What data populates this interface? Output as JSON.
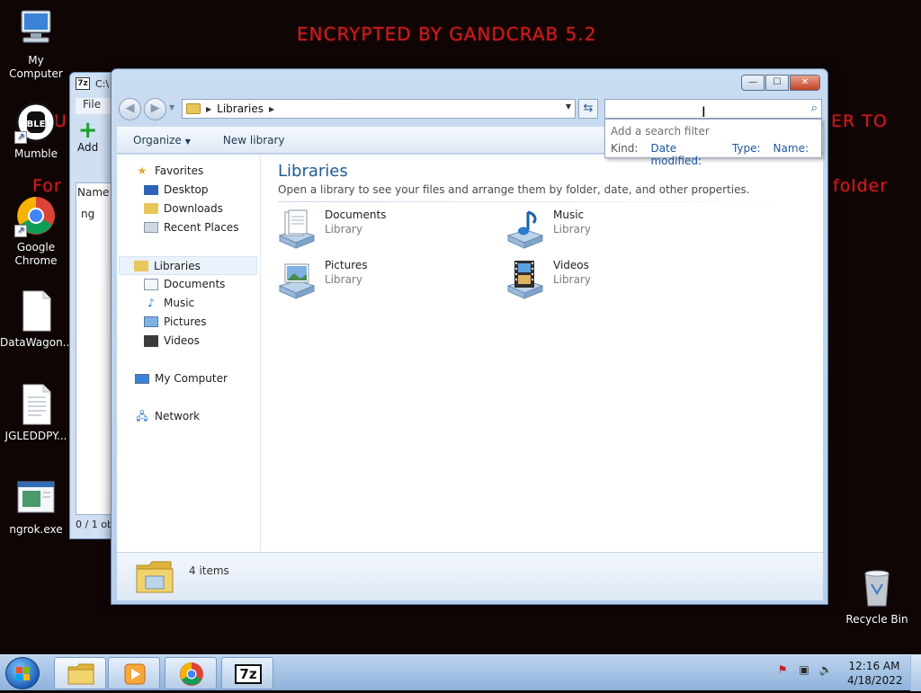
{
  "wallpaper": {
    "title": "ENCRYPTED BY GANDCRAB 5.2",
    "left_fragment_1": "U",
    "left_fragment_2": "For",
    "right_fragment_1": "ER TO",
    "right_fragment_2": "folder"
  },
  "desktop_icons": [
    {
      "label": "My Computer"
    },
    {
      "label": "Mumble"
    },
    {
      "label": "Google Chrome"
    },
    {
      "label": "DataWagon..."
    },
    {
      "label": "JGLEDDPY..."
    },
    {
      "label": "ngrok.exe"
    },
    {
      "label": "Recycle Bin"
    }
  ],
  "bg_window": {
    "app_badge": "7z",
    "title": "C:\\",
    "file_menu": "File",
    "add_label": "Add",
    "col_name": "Name",
    "row_1": "ng",
    "status": "0 / 1 ob"
  },
  "explorer": {
    "caption": {
      "min": "—",
      "max": "☐",
      "close": "✕"
    },
    "address": {
      "crumb": "Libraries"
    },
    "search": {
      "value": "",
      "placeholder": ""
    },
    "search_popup": {
      "hint": "Add a search filter",
      "kind_label": "Kind:",
      "filters": [
        "Date modified:",
        "Type:",
        "Name:"
      ]
    },
    "toolbar": {
      "organize": "Organize",
      "new_library": "New library"
    },
    "nav": {
      "favorites": "Favorites",
      "desktop": "Desktop",
      "downloads": "Downloads",
      "recent": "Recent Places",
      "libraries": "Libraries",
      "documents": "Documents",
      "music": "Music",
      "pictures": "Pictures",
      "videos": "Videos",
      "computer": "My Computer",
      "network": "Network"
    },
    "main": {
      "title": "Libraries",
      "description": "Open a library to see your files and arrange them by folder, date, and other properties.",
      "libraries": [
        {
          "name": "Documents",
          "type": "Library"
        },
        {
          "name": "Music",
          "type": "Library"
        },
        {
          "name": "Pictures",
          "type": "Library"
        },
        {
          "name": "Videos",
          "type": "Library"
        }
      ]
    },
    "details": {
      "count": "4 items"
    }
  },
  "taskbar": {
    "time": "12:16 AM",
    "date": "4/18/2022",
    "sevenzip_badge": "7z"
  },
  "colors": {
    "wallpaper_text": "#c81e1e",
    "title_blue": "#1e5b92",
    "window_frame": "#c9dcf1"
  }
}
